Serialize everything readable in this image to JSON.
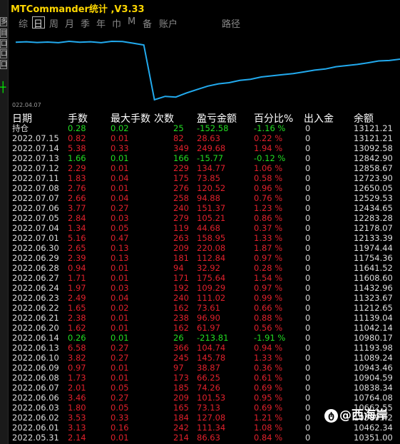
{
  "window": {
    "title": "MTCommander统计 ,V3.33"
  },
  "sidebar": {
    "buttons": [
      "多",
      "目",
      "口",
      "口",
      "口"
    ]
  },
  "tabs": [
    {
      "label": "综",
      "active": false
    },
    {
      "label": "日",
      "active": true
    },
    {
      "label": "周",
      "active": false
    },
    {
      "label": "月",
      "active": false
    },
    {
      "label": "季",
      "active": false
    },
    {
      "label": "年",
      "active": false
    },
    {
      "label": "巾",
      "active": false
    },
    {
      "label": "M",
      "active": false
    },
    {
      "label": "备",
      "active": false
    },
    {
      "label": "账户",
      "active": false
    },
    {
      "label": "路径",
      "active": false
    }
  ],
  "chart_data": {
    "type": "line",
    "x_start_label": "022.04.07",
    "line_color": "#22aaee",
    "values": [
      13720,
      13740,
      13710,
      13730,
      13700,
      13760,
      13720,
      13740,
      13700,
      13760,
      13750,
      13680,
      13600,
      11200,
      11350,
      11320,
      11500,
      11650,
      11800,
      11900,
      11950,
      12050,
      12100,
      12200,
      12250,
      12300,
      12350,
      12420,
      12500,
      12550,
      12650,
      12700,
      12750,
      12820,
      12900,
      12920,
      12980
    ]
  },
  "table": {
    "headers": {
      "date": "日期",
      "lots": "手数",
      "max": "最大手数",
      "count": "次数",
      "pnl": "盈亏金额",
      "pct": "百分比%",
      "io": "出入金",
      "bal": "余额"
    },
    "rows": [
      {
        "date": "持仓",
        "lots": "0.28",
        "max": "0.02",
        "count": "25",
        "pnl": "-152.58",
        "pct": "-1.16 %",
        "io": "0",
        "bal": "13121.21",
        "color": "green"
      },
      {
        "date": "2022.07.15",
        "lots": "0.82",
        "max": "0.01",
        "count": "82",
        "pnl": "28.63",
        "pct": "0.22 %",
        "io": "0",
        "bal": "13121.21",
        "color": "red"
      },
      {
        "date": "2022.07.14",
        "lots": "5.38",
        "max": "0.33",
        "count": "349",
        "pnl": "249.68",
        "pct": "1.94 %",
        "io": "0",
        "bal": "13092.58",
        "color": "red"
      },
      {
        "date": "2022.07.13",
        "lots": "1.66",
        "max": "0.01",
        "count": "166",
        "pnl": "-15.77",
        "pct": "-0.12 %",
        "io": "0",
        "bal": "12842.90",
        "color": "green"
      },
      {
        "date": "2022.07.12",
        "lots": "2.29",
        "max": "0.01",
        "count": "229",
        "pnl": "134.77",
        "pct": "1.06 %",
        "io": "0",
        "bal": "12858.67",
        "color": "red"
      },
      {
        "date": "2022.07.11",
        "lots": "1.83",
        "max": "0.04",
        "count": "175",
        "pnl": "73.85",
        "pct": "0.58 %",
        "io": "0",
        "bal": "12723.90",
        "color": "red"
      },
      {
        "date": "2022.07.08",
        "lots": "2.76",
        "max": "0.01",
        "count": "276",
        "pnl": "120.52",
        "pct": "0.96 %",
        "io": "0",
        "bal": "12650.05",
        "color": "red"
      },
      {
        "date": "2022.07.07",
        "lots": "2.66",
        "max": "0.04",
        "count": "258",
        "pnl": "94.88",
        "pct": "0.76 %",
        "io": "0",
        "bal": "12529.53",
        "color": "red"
      },
      {
        "date": "2022.07.06",
        "lots": "3.77",
        "max": "0.27",
        "count": "240",
        "pnl": "151.37",
        "pct": "1.23 %",
        "io": "0",
        "bal": "12434.65",
        "color": "red"
      },
      {
        "date": "2022.07.05",
        "lots": "2.84",
        "max": "0.03",
        "count": "279",
        "pnl": "105.21",
        "pct": "0.86 %",
        "io": "0",
        "bal": "12283.28",
        "color": "red"
      },
      {
        "date": "2022.07.04",
        "lots": "1.34",
        "max": "0.05",
        "count": "119",
        "pnl": "44.68",
        "pct": "0.37 %",
        "io": "0",
        "bal": "12178.07",
        "color": "red"
      },
      {
        "date": "2022.07.01",
        "lots": "5.16",
        "max": "0.47",
        "count": "263",
        "pnl": "158.95",
        "pct": "1.33 %",
        "io": "0",
        "bal": "12133.39",
        "color": "red"
      },
      {
        "date": "2022.06.30",
        "lots": "2.65",
        "max": "0.13",
        "count": "209",
        "pnl": "220.08",
        "pct": "1.87 %",
        "io": "0",
        "bal": "11974.44",
        "color": "red"
      },
      {
        "date": "2022.06.29",
        "lots": "2.39",
        "max": "0.13",
        "count": "181",
        "pnl": "112.84",
        "pct": "0.97 %",
        "io": "0",
        "bal": "11754.36",
        "color": "red"
      },
      {
        "date": "2022.06.28",
        "lots": "0.94",
        "max": "0.01",
        "count": "94",
        "pnl": "32.92",
        "pct": "0.28 %",
        "io": "0",
        "bal": "11641.52",
        "color": "red"
      },
      {
        "date": "2022.06.27",
        "lots": "1.71",
        "max": "0.01",
        "count": "171",
        "pnl": "175.64",
        "pct": "1.54 %",
        "io": "0",
        "bal": "11608.60",
        "color": "red"
      },
      {
        "date": "2022.06.24",
        "lots": "1.97",
        "max": "0.03",
        "count": "192",
        "pnl": "109.29",
        "pct": "0.97 %",
        "io": "0",
        "bal": "11432.96",
        "color": "red"
      },
      {
        "date": "2022.06.23",
        "lots": "2.49",
        "max": "0.04",
        "count": "240",
        "pnl": "111.02",
        "pct": "0.99 %",
        "io": "0",
        "bal": "11323.67",
        "color": "red"
      },
      {
        "date": "2022.06.22",
        "lots": "1.65",
        "max": "0.02",
        "count": "162",
        "pnl": "73.61",
        "pct": "0.66 %",
        "io": "0",
        "bal": "11212.65",
        "color": "red"
      },
      {
        "date": "2022.06.21",
        "lots": "2.38",
        "max": "0.01",
        "count": "238",
        "pnl": "96.90",
        "pct": "0.88 %",
        "io": "0",
        "bal": "11139.04",
        "color": "red"
      },
      {
        "date": "2022.06.20",
        "lots": "1.62",
        "max": "0.01",
        "count": "162",
        "pnl": "61.97",
        "pct": "0.56 %",
        "io": "0",
        "bal": "11042.14",
        "color": "red"
      },
      {
        "date": "2022.06.14",
        "lots": "0.26",
        "max": "0.01",
        "count": "26",
        "pnl": "-213.81",
        "pct": "-1.91 %",
        "io": "0",
        "bal": "10980.17",
        "color": "green"
      },
      {
        "date": "2022.06.13",
        "lots": "6.58",
        "max": "0.27",
        "count": "366",
        "pnl": "104.74",
        "pct": "0.94 %",
        "io": "0",
        "bal": "11193.98",
        "color": "red"
      },
      {
        "date": "2022.06.10",
        "lots": "3.82",
        "max": "0.27",
        "count": "245",
        "pnl": "145.78",
        "pct": "1.33 %",
        "io": "0",
        "bal": "11089.24",
        "color": "red"
      },
      {
        "date": "2022.06.09",
        "lots": "0.97",
        "max": "0.01",
        "count": "97",
        "pnl": "38.87",
        "pct": "0.36 %",
        "io": "0",
        "bal": "10943.46",
        "color": "red"
      },
      {
        "date": "2022.06.08",
        "lots": "1.73",
        "max": "0.01",
        "count": "173",
        "pnl": "66.25",
        "pct": "0.61 %",
        "io": "0",
        "bal": "10904.59",
        "color": "red"
      },
      {
        "date": "2022.06.07",
        "lots": "2.01",
        "max": "0.05",
        "count": "185",
        "pnl": "74.26",
        "pct": "0.69 %",
        "io": "0",
        "bal": "10838.34",
        "color": "red"
      },
      {
        "date": "2022.06.06",
        "lots": "3.46",
        "max": "0.27",
        "count": "209",
        "pnl": "101.53",
        "pct": "0.95 %",
        "io": "0",
        "bal": "10764.08",
        "color": "red"
      },
      {
        "date": "2022.06.03",
        "lots": "1.80",
        "max": "0.05",
        "count": "165",
        "pnl": "73.13",
        "pct": "0.69 %",
        "io": "0",
        "bal": "10662.55",
        "color": "red"
      },
      {
        "date": "2022.06.02",
        "lots": "3.53",
        "max": "0.33",
        "count": "184",
        "pnl": "127.08",
        "pct": "1.21 %",
        "io": "0",
        "bal": "10589.42",
        "color": "red"
      },
      {
        "date": "2022.06.01",
        "lots": "3.13",
        "max": "0.16",
        "count": "242",
        "pnl": "111.34",
        "pct": "1.08 %",
        "io": "0",
        "bal": "10462.34",
        "color": "red"
      },
      {
        "date": "2022.05.31",
        "lots": "2.14",
        "max": "0.01",
        "count": "214",
        "pnl": "86.63",
        "pct": "0.84 %",
        "io": "0",
        "bal": "10351.00",
        "color": "red"
      }
    ]
  },
  "watermark": {
    "icon": "social-logo-icon",
    "text": "@西海岸"
  }
}
